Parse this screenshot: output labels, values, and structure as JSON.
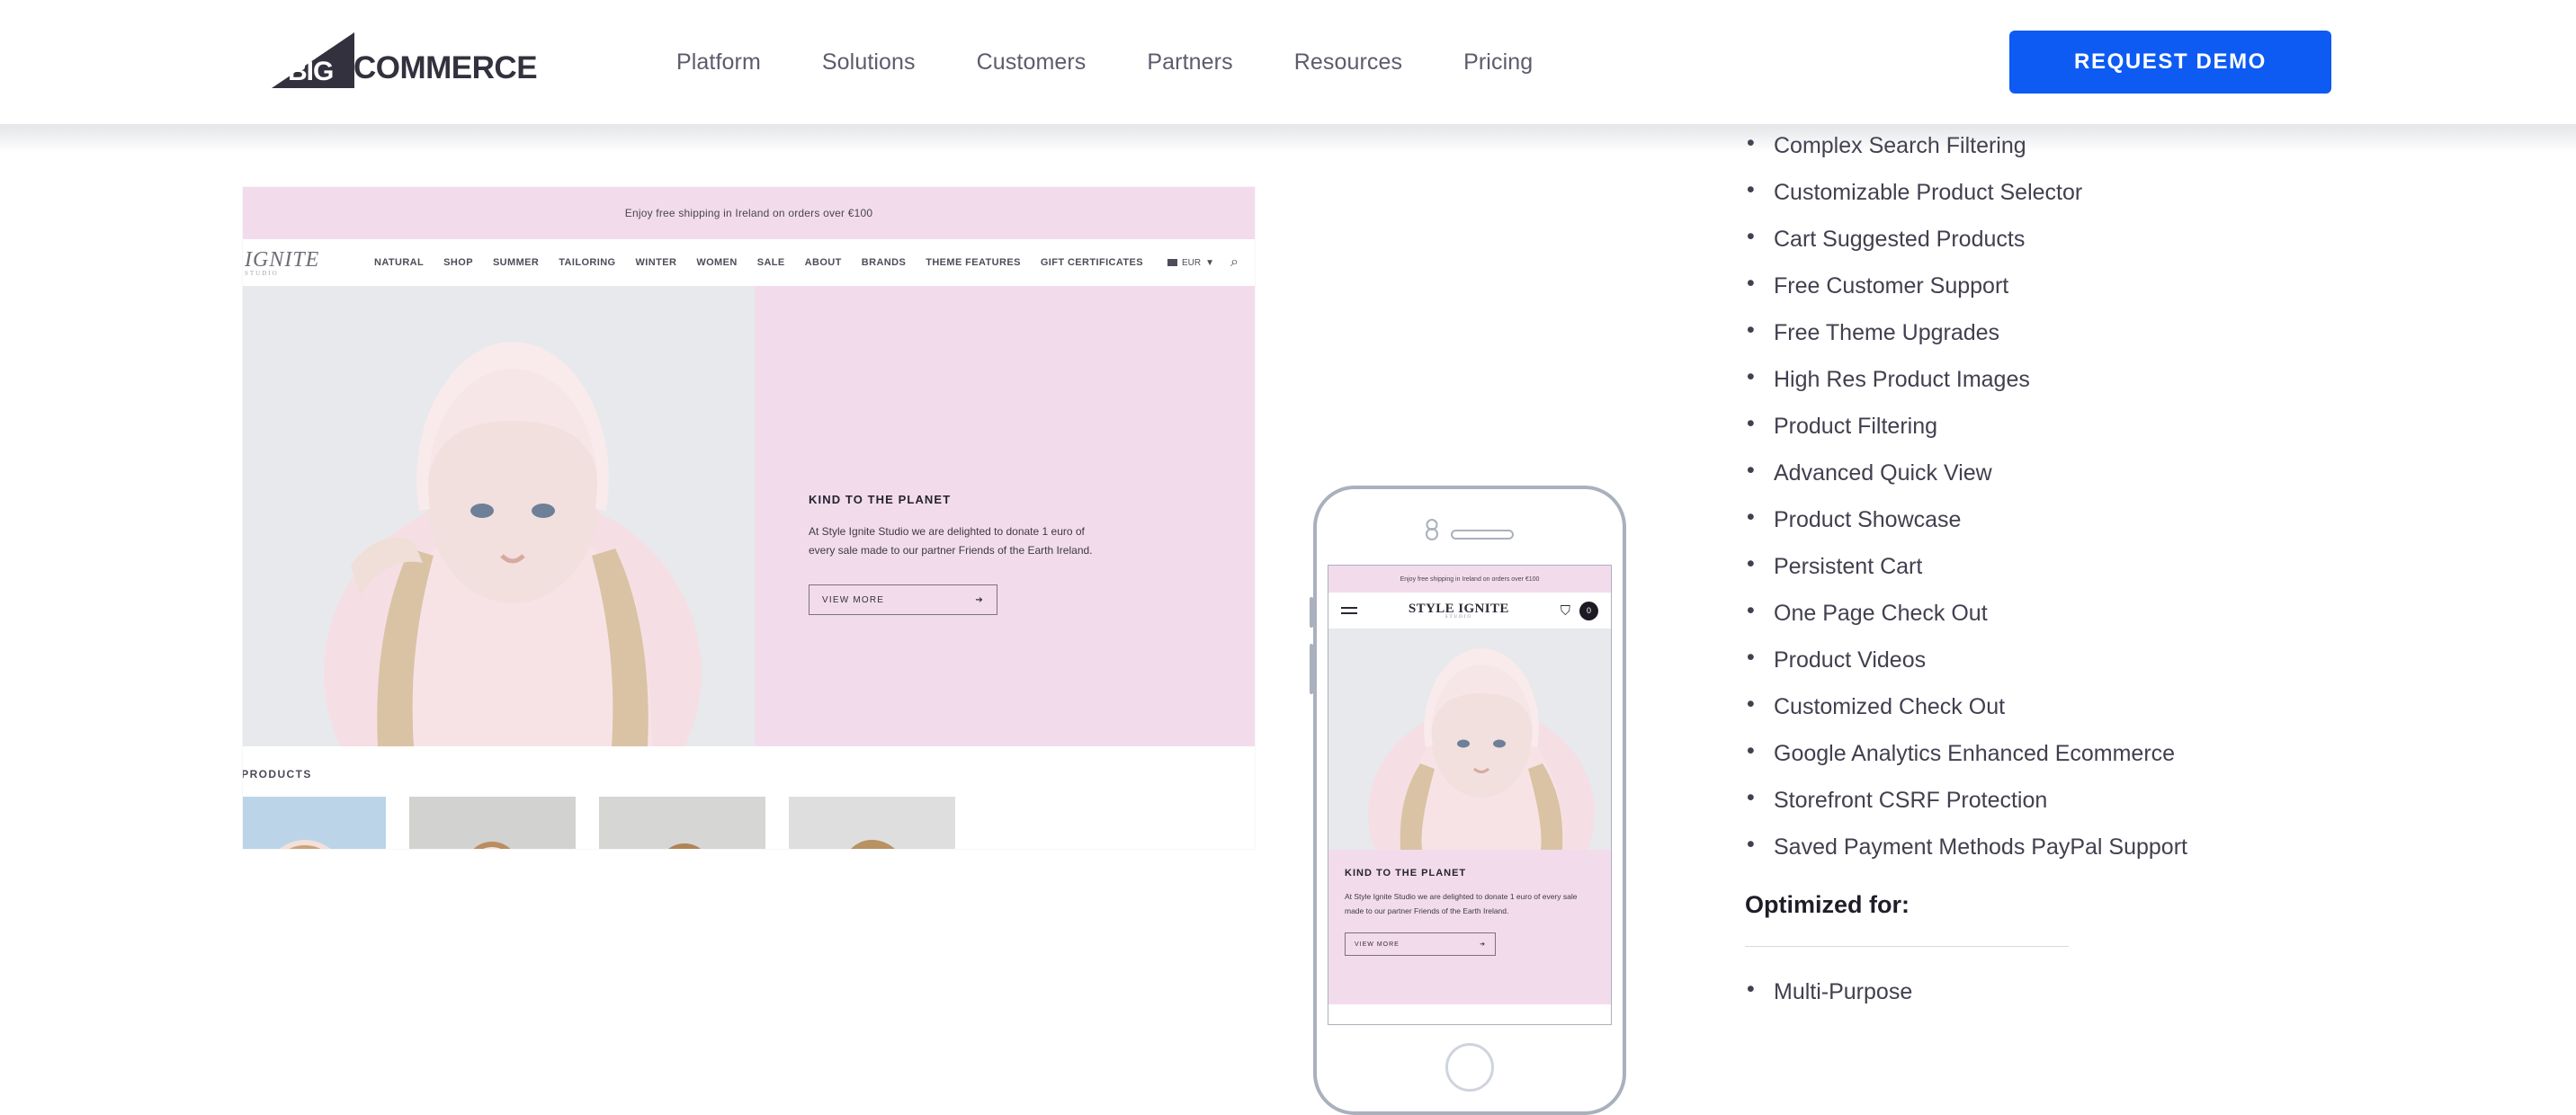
{
  "header": {
    "logo": {
      "mark_text": "BIG",
      "word": "COMMERCE"
    },
    "nav": [
      {
        "label": "Platform"
      },
      {
        "label": "Solutions"
      },
      {
        "label": "Customers"
      },
      {
        "label": "Partners"
      },
      {
        "label": "Resources"
      },
      {
        "label": "Pricing"
      }
    ],
    "cta": {
      "label": "REQUEST DEMO",
      "color": "#0D5BF2"
    }
  },
  "desktop_preview": {
    "announcement": "Enjoy free shipping in Ireland on orders over €100",
    "store_logo": {
      "name": "IGNITE",
      "sub": "STUDIO"
    },
    "nav": [
      {
        "label": "NATURAL"
      },
      {
        "label": "SHOP"
      },
      {
        "label": "SUMMER"
      },
      {
        "label": "TAILORING"
      },
      {
        "label": "WINTER"
      },
      {
        "label": "WOMEN"
      },
      {
        "label": "SALE"
      },
      {
        "label": "ABOUT"
      },
      {
        "label": "BRANDS"
      },
      {
        "label": "THEME FEATURES"
      },
      {
        "label": "GIFT CERTIFICATES"
      }
    ],
    "currency": "EUR",
    "currency_caret": "▼",
    "search_icon": "⌕",
    "hero": {
      "title": "KIND TO THE PLANET",
      "body": "At Style Ignite Studio we are delighted to donate 1 euro of every sale made to our partner Friends of the Earth Ireland.",
      "button": "VIEW MORE",
      "button_arrow": "➔"
    },
    "featured_label": "ED PRODUCTS",
    "panel_color": "#F2DCEC"
  },
  "phone_preview": {
    "announcement": "Enjoy free shipping in Ireland on orders over €100",
    "logo": {
      "name": "STYLE IGNITE",
      "sub": "STUDIO"
    },
    "cart_count": "0",
    "user_icon": "⛉",
    "hero": {
      "title": "KIND TO THE PLANET",
      "body": "At Style Ignite Studio we are delighted to donate 1 euro of every sale made to our partner Friends of the Earth Ireland.",
      "button": "VIEW MORE",
      "button_arrow": "➔"
    }
  },
  "features": {
    "items": [
      {
        "label": "Complex Search Filtering"
      },
      {
        "label": "Customizable Product Selector"
      },
      {
        "label": "Cart Suggested Products"
      },
      {
        "label": "Free Customer Support"
      },
      {
        "label": "Free Theme Upgrades"
      },
      {
        "label": "High Res Product Images"
      },
      {
        "label": "Product Filtering"
      },
      {
        "label": "Advanced Quick View"
      },
      {
        "label": "Product Showcase"
      },
      {
        "label": "Persistent Cart"
      },
      {
        "label": "One Page Check Out"
      },
      {
        "label": "Product Videos"
      },
      {
        "label": "Customized Check Out"
      },
      {
        "label": "Google Analytics Enhanced Ecommerce"
      },
      {
        "label": "Storefront CSRF Protection"
      },
      {
        "label": "Saved Payment Methods PayPal Support"
      }
    ],
    "optimized_heading": "Optimized for:",
    "optimized_items": [
      {
        "label": "Multi-Purpose"
      }
    ]
  }
}
